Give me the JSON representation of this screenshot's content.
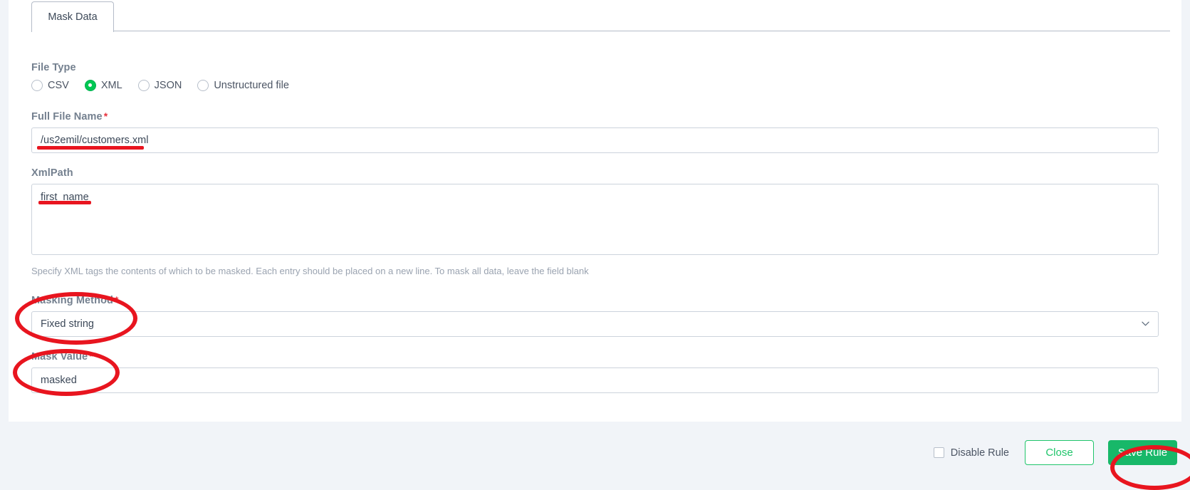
{
  "tabs": [
    {
      "label": "Mask Data",
      "active": true
    }
  ],
  "form": {
    "file_type": {
      "label": "File Type",
      "options": [
        {
          "label": "CSV",
          "selected": false
        },
        {
          "label": "XML",
          "selected": true
        },
        {
          "label": "JSON",
          "selected": false
        },
        {
          "label": "Unstructured file",
          "selected": false
        }
      ]
    },
    "full_file_name": {
      "label": "Full File Name",
      "required": true,
      "value": "/us2emil/customers.xml",
      "placeholder": ""
    },
    "xml_path": {
      "label": "XmlPath",
      "required": false,
      "value": "first_name",
      "placeholder": "",
      "help": "Specify XML tags the contents of which to be masked. Each entry should be placed on a new line. To mask all data, leave the field blank"
    },
    "masking_method": {
      "label": "Masking Method",
      "required": true,
      "value": "Fixed string",
      "options": [
        "Fixed string"
      ]
    },
    "mask_value": {
      "label": "Mask Value",
      "required": true,
      "value": "masked",
      "placeholder": ""
    },
    "required_marker": "*"
  },
  "footer": {
    "disable_rule": {
      "label": "Disable Rule",
      "checked": false
    },
    "close_label": "Close",
    "save_label": "Save Rule"
  },
  "colors": {
    "accent_green": "#18b869",
    "outline_green": "#20c56b",
    "annotation_red": "#e8151f",
    "required_red": "#e8313c",
    "label_gray": "#74808f",
    "page_bg": "#f1f4f8"
  }
}
